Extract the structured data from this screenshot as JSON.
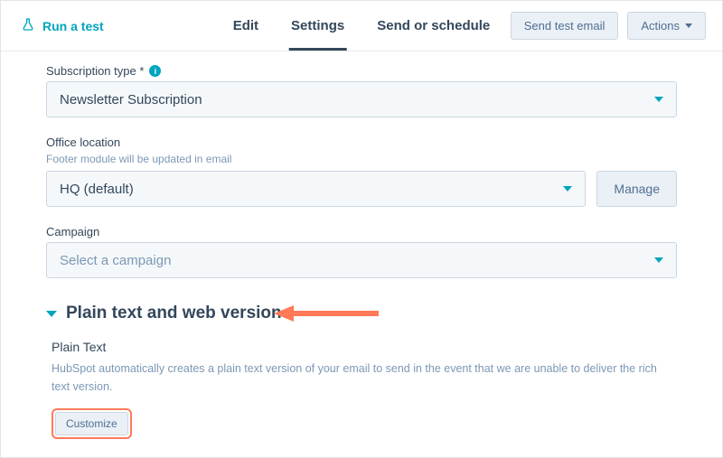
{
  "header": {
    "run_test_label": "Run a test",
    "tabs": [
      "Edit",
      "Settings",
      "Send or schedule"
    ],
    "active_tab_index": 1,
    "send_test_label": "Send test email",
    "actions_label": "Actions"
  },
  "fields": {
    "subscription": {
      "label": "Subscription type *",
      "value": "Newsletter Subscription"
    },
    "office": {
      "label": "Office location",
      "help": "Footer module will be updated in email",
      "value": "HQ (default)",
      "manage_label": "Manage"
    },
    "campaign": {
      "label": "Campaign",
      "placeholder": "Select a campaign"
    }
  },
  "section": {
    "title": "Plain text and web version",
    "plain_text_heading": "Plain Text",
    "plain_text_desc": "HubSpot automatically creates a plain text version of your email to send in the event that we are unable to deliver the rich text version.",
    "customize_label": "Customize"
  },
  "colors": {
    "accent": "#00a4bd",
    "annotation": "#ff7a59"
  }
}
